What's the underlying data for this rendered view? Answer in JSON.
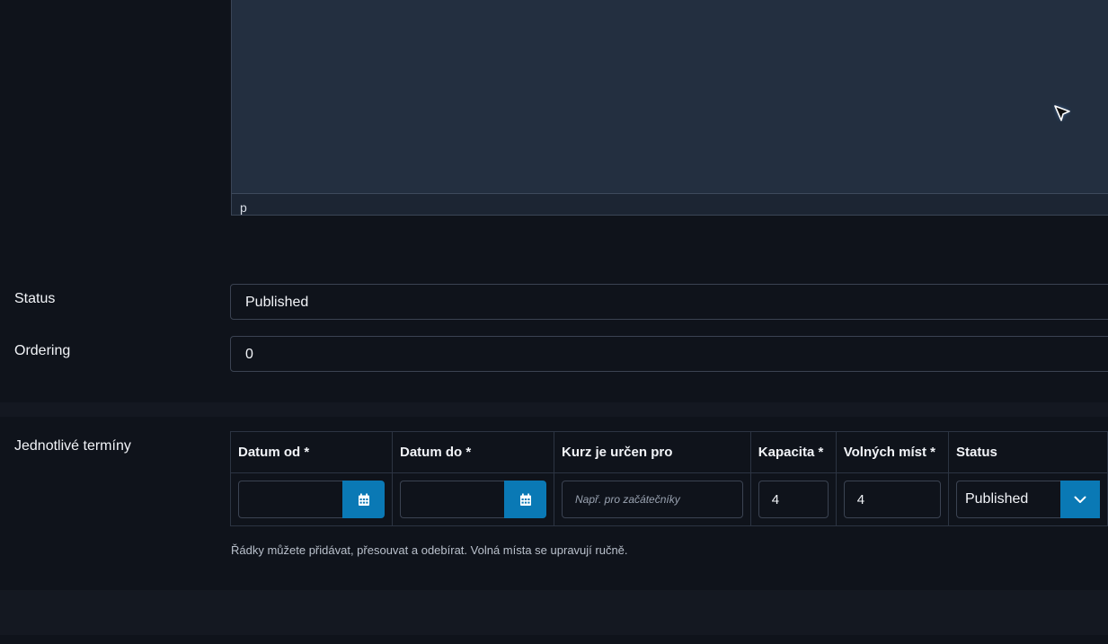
{
  "editor": {
    "path_text": "p"
  },
  "fields": {
    "status": {
      "label": "Status",
      "value": "Published"
    },
    "ordering": {
      "label": "Ordering",
      "value": "0"
    }
  },
  "terms": {
    "label": "Jednotlivé termíny",
    "columns": [
      "Datum od *",
      "Datum do *",
      "Kurz je určen pro",
      "Kapacita *",
      "Volných míst *",
      "Status"
    ],
    "row": {
      "date_from": "",
      "date_to": "",
      "audience_placeholder": "Např. pro začátečníky",
      "capacity": "4",
      "free_places": "4",
      "status": "Published"
    },
    "help": "Řádky můžete přidávat, přesouvat a odebírat. Volná místa se upravují ručně."
  },
  "colors": {
    "accent": "#0a79b5",
    "background": "#0f131b",
    "editor_bg": "#232f40"
  },
  "icons": [
    "calendar-icon",
    "chevron-down-icon",
    "mouse-cursor-icon"
  ]
}
